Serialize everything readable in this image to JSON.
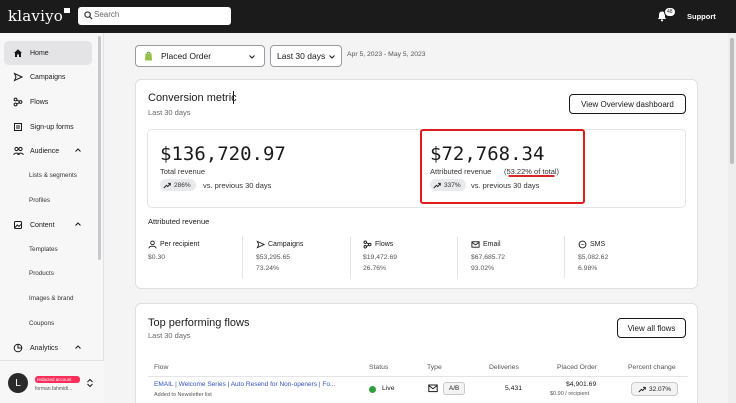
{
  "app": {
    "logo": "klaviyo",
    "search_placeholder": "Search",
    "notification_count": "48",
    "support_label": "Support"
  },
  "sidebar": {
    "items": [
      {
        "label": "Home",
        "icon": "home-icon",
        "active": true
      },
      {
        "label": "Campaigns",
        "icon": "send-icon"
      },
      {
        "label": "Flows",
        "icon": "flows-icon"
      },
      {
        "label": "Sign-up forms",
        "icon": "form-icon"
      },
      {
        "label": "Audience",
        "icon": "people-icon",
        "expanded": true
      },
      {
        "label": "Content",
        "icon": "content-icon",
        "expanded": true
      },
      {
        "label": "Analytics",
        "icon": "analytics-icon",
        "expanded": true
      }
    ],
    "audience_sub": [
      "Lists & segments",
      "Profiles"
    ],
    "content_sub": [
      "Templates",
      "Products",
      "Images & brand",
      "Coupons"
    ],
    "account": {
      "avatar_letter": "L",
      "name": "redacted account",
      "email": "forman.fahmidi..."
    }
  },
  "filters": {
    "metric": "Placed Order",
    "period": "Last 30 days",
    "date_range": "Apr 5, 2023 - May 5, 2023"
  },
  "conversion": {
    "title": "Conversion metric",
    "subtitle": "Last 30 days",
    "overview_button": "View Overview dashboard",
    "total": {
      "value": "$136,720.97",
      "label": "Total revenue",
      "change": "286%",
      "vs": "vs. previous 30 days"
    },
    "attributed": {
      "value": "$72,768.34",
      "label": "Attributed revenue",
      "share": "(53.22% of total)",
      "change": "337%",
      "vs": "vs. previous 30 days"
    },
    "breakdown_title": "Attributed revenue",
    "breakdown": [
      {
        "label": "Per recipient",
        "icon": "per-recipient-icon",
        "value": "$0.30",
        "percent": ""
      },
      {
        "label": "Campaigns",
        "icon": "send-icon",
        "value": "$53,295.65",
        "percent": "73.24%"
      },
      {
        "label": "Flows",
        "icon": "flows-icon",
        "value": "$19,472.69",
        "percent": "26.76%"
      },
      {
        "label": "Email",
        "icon": "email-icon",
        "value": "$67,685.72",
        "percent": "93.02%"
      },
      {
        "label": "SMS",
        "icon": "sms-icon",
        "value": "$5,082.62",
        "percent": "6.98%"
      }
    ]
  },
  "top_flows": {
    "title": "Top performing flows",
    "subtitle": "Last 30 days",
    "view_all_button": "View all flows",
    "columns": [
      "Flow",
      "Status",
      "Type",
      "Deliveries",
      "Placed Order",
      "Percent change"
    ],
    "rows": [
      {
        "flow": "EMAIL | Welcome Series | Auto Resend for Non-openers | Fo...",
        "flow_sub": "Added to Newsletter list",
        "status": "Live",
        "type": "A/B",
        "deliveries": "5,431",
        "placed_order": "$4,901.69",
        "placed_order_sub": "$0.90 / recipient",
        "percent_change": "32.07%"
      }
    ]
  },
  "colors": {
    "accent_red": "#e01b1b",
    "link_blue": "#3053c7",
    "live_green": "#2e9e3e",
    "topbar": "#1b1b1b"
  }
}
